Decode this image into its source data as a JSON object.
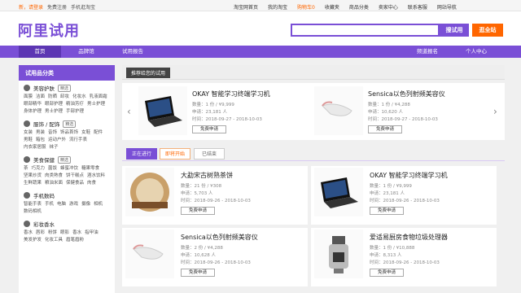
{
  "topbar": {
    "greeting": "新，请登录",
    "register": "免费注册",
    "mobile": "手机逛淘宝",
    "right": [
      "淘宝网首页",
      "我的淘宝",
      "购物车0",
      "收藏夹",
      "商品分类",
      "卖家中心",
      "联系客服",
      "网站导航"
    ]
  },
  "header": {
    "logo": "阿里试用",
    "search_placeholder": "",
    "search_button": "搜试用",
    "trial_button": "逛全站"
  },
  "nav": {
    "items": [
      "首页",
      "品牌馆",
      "试用报告"
    ],
    "right": [
      "频道报名",
      "个人中心"
    ]
  },
  "sidebar": {
    "title": "试用品分类",
    "categories": [
      {
        "name": "美容护肤",
        "tag": "精选",
        "subs": [
          "面膜",
          "洁面",
          "防晒",
          "卸妆",
          "化妆水",
          "乳液面霜",
          "眼部精华",
          "眼部护理",
          "精油芳疗",
          "男士护理",
          "身体护理",
          "男士护理",
          "手部护理"
        ]
      },
      {
        "name": "服饰 / 配饰",
        "tag": "精选",
        "subs": [
          "女装",
          "男装",
          "音饰",
          "饰品首饰",
          "女鞋",
          "配件",
          "男鞋",
          "箱包",
          "运动户外",
          "流行手表",
          "内衣家居服",
          "袜子"
        ]
      },
      {
        "name": "美食保健",
        "tag": "精选",
        "subs": [
          "茶",
          "巧克力",
          "菌饭",
          "蜂蜜冲饮",
          "糖果零食",
          "坚果炒货",
          "肉类熟食",
          "饼干糕点",
          "酒水饮料",
          "生鲜蔬果",
          "粮油米面",
          "保健食品",
          "肉食"
        ]
      },
      {
        "name": "手机数码",
        "tag": "",
        "subs": [
          "智能手表",
          "手机",
          "电脑",
          "游戏",
          "摄像",
          "相机",
          "数码相机"
        ]
      },
      {
        "name": "彩妆香水",
        "tag": "",
        "subs": [
          "香水",
          "唇彩",
          "粉饼",
          "眼影",
          "香水",
          "指甲油",
          "美发护发",
          "化妆工具",
          "眉笔眉粉"
        ]
      }
    ]
  },
  "recommend": {
    "label": "推荐给您的试用"
  },
  "carousel": [
    {
      "name": "OKAY 智能学习终端学习机",
      "qty": "数量：1 份 / ¥9,999",
      "apply": "申请：23,181 人",
      "time": "时间：2018-09-27 - 2018-10-03",
      "button": "免费申请"
    },
    {
      "name": "Sensica以色列射频美容仪",
      "qty": "数量：1 份 / ¥4,288",
      "apply": "申请：10,620 人",
      "time": "时间：2018-09-27 - 2018-10-03",
      "button": "免费申请"
    }
  ],
  "tabs": [
    "正在进行",
    "即将开始",
    "已结束"
  ],
  "products": [
    {
      "name": "大勐宋古树熟茶饼",
      "qty": "数量：21 份 / ¥308",
      "apply": "申请：5,703 人",
      "time": "时间：2018-09-26 - 2018-10-03",
      "button": "免费申请"
    },
    {
      "name": "OKAY 智能学习终端学习机",
      "qty": "数量：1 份 / ¥9,999",
      "apply": "申请：23,181 人",
      "time": "时间：2018-09-26 - 2018-10-03",
      "button": "免费申请"
    },
    {
      "name": "Sensica以色列射频美容仪",
      "qty": "数量：2 份 / ¥4,288",
      "apply": "申请：10,628 人",
      "time": "时间：2018-09-26 - 2018-10-03",
      "button": "免费申请"
    },
    {
      "name": "爱适易厨房食物垃圾处理器",
      "qty": "数量：1 份 / ¥10,888",
      "apply": "申请：8,313 人",
      "time": "时间：2018-09-26 - 2018-10-03",
      "button": "免费申请"
    }
  ],
  "colors": {
    "accent": "#7a4fd6",
    "orange": "#ff6600"
  }
}
